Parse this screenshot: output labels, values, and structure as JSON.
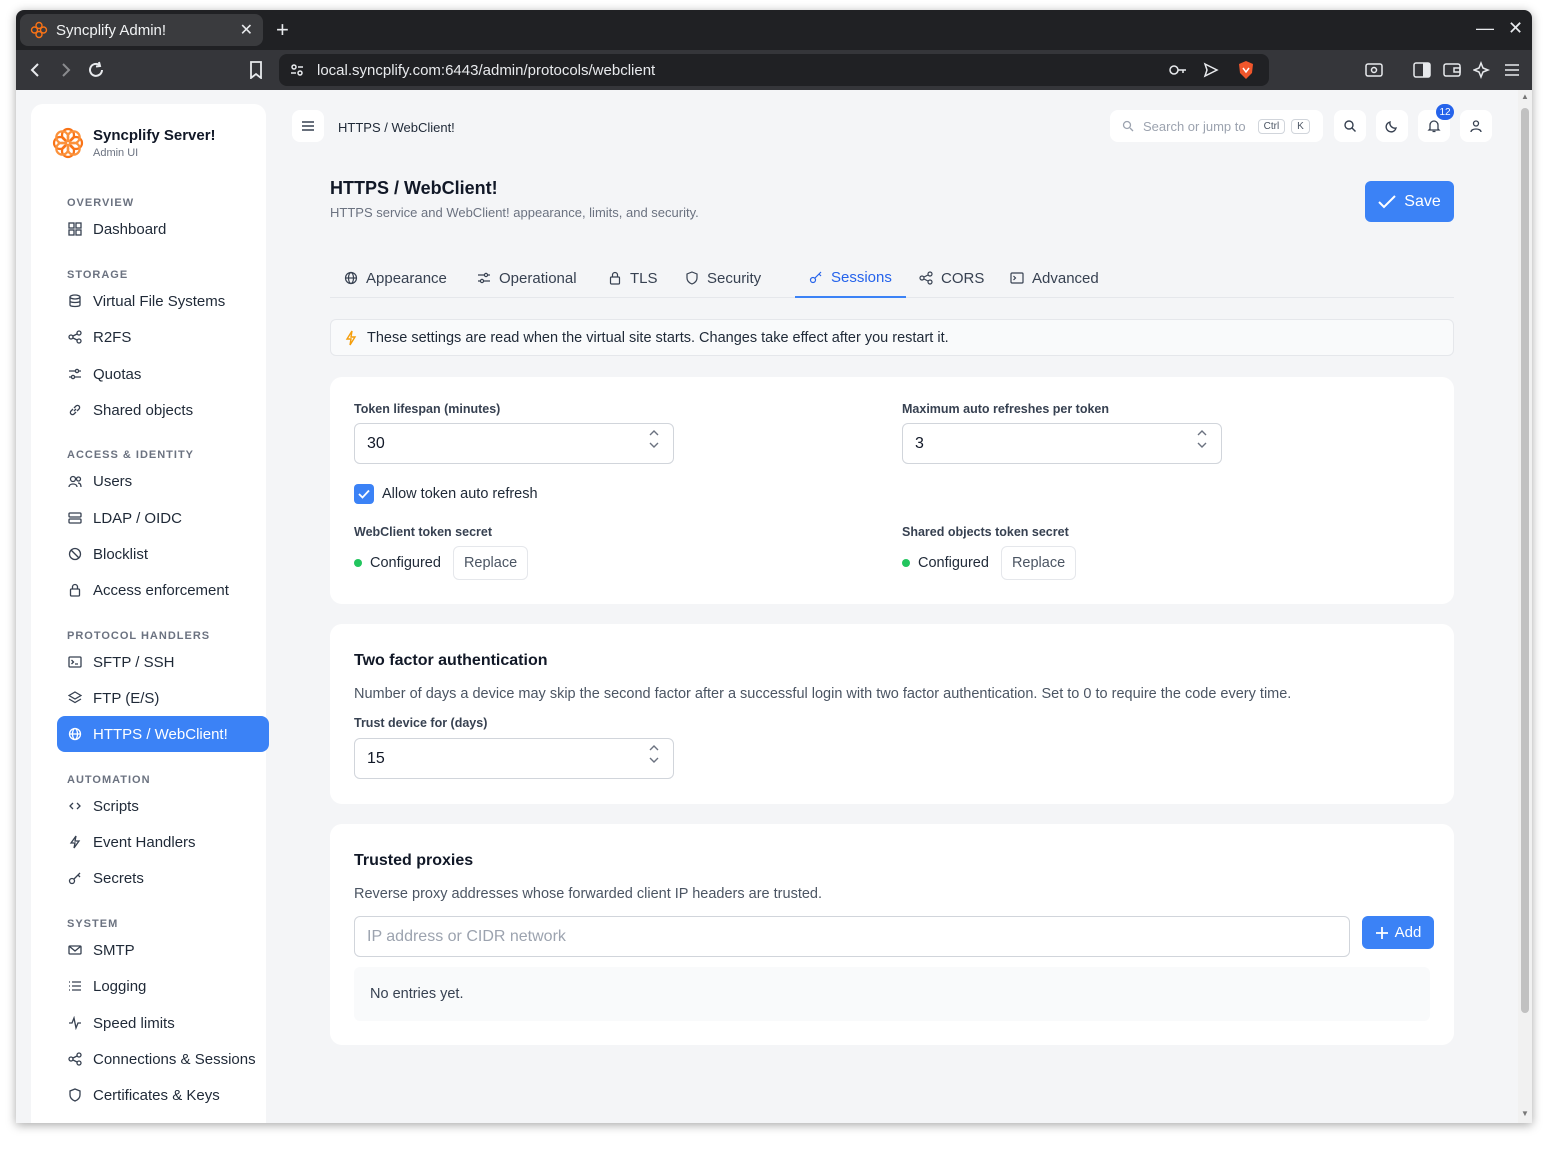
{
  "browser": {
    "tab_title": "Syncplify Admin!",
    "url": "local.syncplify.com:6443/admin/protocols/webclient"
  },
  "sidebar": {
    "brand_name": "Syncplify Server!",
    "brand_sub": "Admin UI",
    "sections": {
      "overview": "OVERVIEW",
      "storage": "STORAGE",
      "access": "ACCESS & IDENTITY",
      "protocols": "PROTOCOL HANDLERS",
      "automation": "AUTOMATION",
      "system": "SYSTEM"
    },
    "items": {
      "dashboard": "Dashboard",
      "vfs": "Virtual File Systems",
      "r2fs": "R2FS",
      "quotas": "Quotas",
      "shared": "Shared objects",
      "users": "Users",
      "ldap": "LDAP / OIDC",
      "blocklist": "Blocklist",
      "access_enf": "Access enforcement",
      "sftp": "SFTP / SSH",
      "ftp": "FTP (E/S)",
      "https": "HTTPS / WebClient!",
      "scripts": "Scripts",
      "events": "Event Handlers",
      "secrets": "Secrets",
      "smtp": "SMTP",
      "logging": "Logging",
      "speed": "Speed limits",
      "connections": "Connections & Sessions",
      "certs": "Certificates & Keys"
    }
  },
  "header": {
    "breadcrumb": "HTTPS / WebClient!",
    "search_placeholder": "Search or jump to",
    "kbd_ctrl": "Ctrl",
    "kbd_k": "K",
    "notification_count": "12"
  },
  "page": {
    "title": "HTTPS / WebClient!",
    "subtitle": "HTTPS service and WebClient! appearance, limits, and security.",
    "save_label": "Save",
    "tabs": {
      "appearance": "Appearance",
      "operational": "Operational",
      "tls": "TLS",
      "security": "Security",
      "sessions": "Sessions",
      "cors": "CORS",
      "advanced": "Advanced"
    },
    "notice": "These settings are read when the virtual site starts. Changes take effect after you restart it."
  },
  "tokens": {
    "lifespan_label": "Token lifespan (minutes)",
    "lifespan_value": "30",
    "max_refresh_label": "Maximum auto refreshes per token",
    "max_refresh_value": "3",
    "auto_refresh_label": "Allow token auto refresh",
    "webclient_secret_label": "WebClient token secret",
    "webclient_secret_status": "Configured",
    "shared_secret_label": "Shared objects token secret",
    "shared_secret_status": "Configured",
    "replace_label": "Replace"
  },
  "two_factor": {
    "title": "Two factor authentication",
    "description": "Number of days a device may skip the second factor after a successful login with two factor authentication. Set to 0 to require the code every time.",
    "trust_label": "Trust device for (days)",
    "trust_value": "15"
  },
  "proxies": {
    "title": "Trusted proxies",
    "description": "Reverse proxy addresses whose forwarded client IP headers are trusted.",
    "input_placeholder": "IP address or CIDR network",
    "add_label": "Add",
    "empty_text": "No entries yet."
  },
  "colors": {
    "accent": "#3b82f6",
    "status_ok": "#22c55e",
    "brand": "#f97316"
  }
}
